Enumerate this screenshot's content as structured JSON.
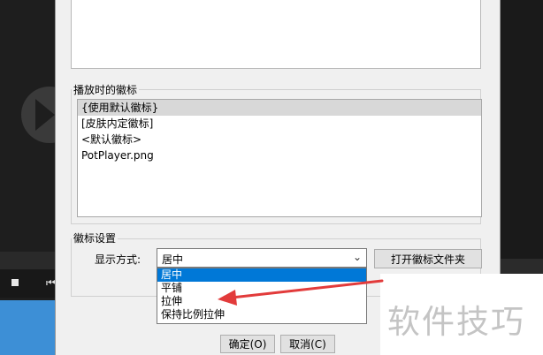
{
  "group_logo": {
    "label": "播放时的徽标"
  },
  "logo_list": {
    "items": [
      {
        "label": "{使用默认徽标}",
        "selected": true
      },
      {
        "label": "[皮肤内定徽标]",
        "selected": false
      },
      {
        "label": "<默认徽标>",
        "selected": false
      },
      {
        "label": "PotPlayer.png",
        "selected": false
      }
    ]
  },
  "group_settings": {
    "label": "徽标设置"
  },
  "display_mode": {
    "label": "显示方式:",
    "value": "居中",
    "options": [
      "居中",
      "平铺",
      "拉伸",
      "保持比例拉伸"
    ],
    "selected_index": 0
  },
  "buttons": {
    "open_folder": "打开徽标文件夹",
    "ok": "确定(O)",
    "cancel": "取消(C)"
  },
  "watermark": "软件技巧",
  "colors": {
    "selection": "#0078d7",
    "arrow": "#e23b3b"
  },
  "icons": {
    "dropdown": "chevron-down-icon",
    "play": "play-icon",
    "stop": "stop-icon"
  }
}
